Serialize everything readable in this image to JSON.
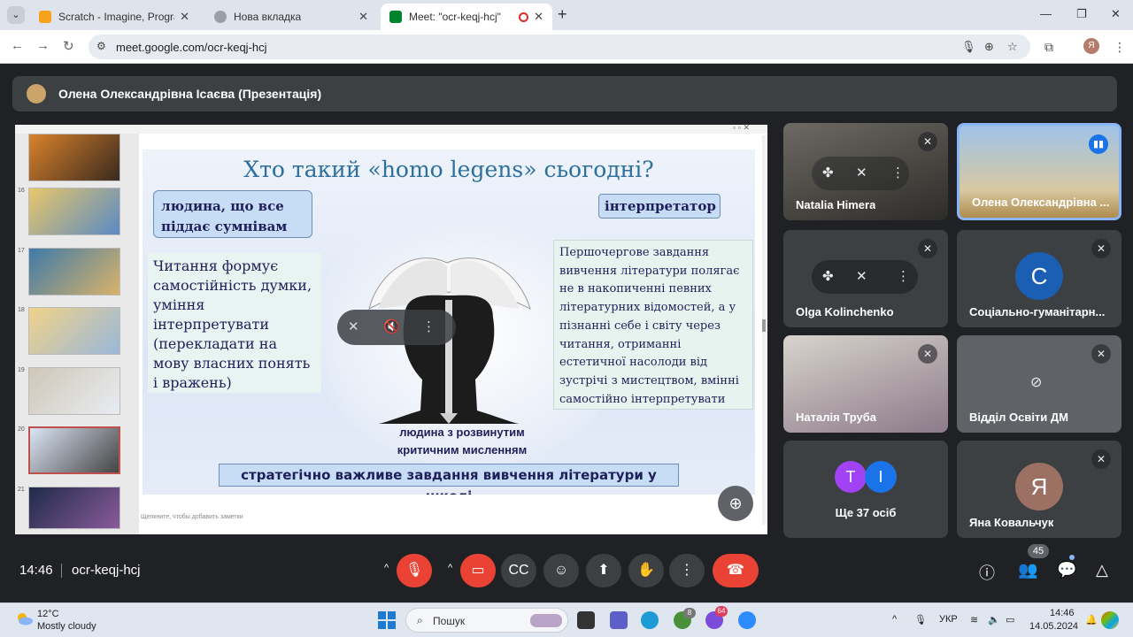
{
  "browser": {
    "tabs": [
      {
        "title": "Scratch - Imagine, Program, Sh",
        "favicon_color": "#f7a21b"
      },
      {
        "title": "Нова вкладка",
        "favicon_color": "#5f6368"
      },
      {
        "title": "Meet: \"ocr-keqj-hcj\"",
        "favicon_color": "#00832d"
      }
    ],
    "url": "meet.google.com/ocr-keqj-hcj",
    "profile_initial": "Я"
  },
  "presenter": {
    "name": "Олена Олександрівна Ісаєва (Презентація)"
  },
  "presentation": {
    "thumbnail_numbers": [
      "16",
      "17",
      "18",
      "19",
      "20",
      "21"
    ],
    "notes_placeholder": "Щелкните, чтобы добавить заметки",
    "slide": {
      "title": "Хто такий «homo legens» сьогодні?",
      "box_doubt": "людина, що все піддає сумнівам",
      "box_interpreter": "інтерпретатор",
      "box_reading": "Читання формує самостійність думки, уміння інтерпретувати (перекладати на мову власних понять і вражень)",
      "box_priority": "Першочергове завдання вивчення літератури полягає не в накопиченні певних літературних відомостей, а у пізнанні себе і світу через читання,  отриманні естетичної насолоди від зустрічі з мистецтвом, вмінні самостійно інтерпретувати",
      "caption": "людина з розвинутим критичним мисленням",
      "bottom_banner": "стратегічно важливе завдання вивчення літератури у школі"
    }
  },
  "participants": [
    {
      "name": "Natalia Himera",
      "state": "muted"
    },
    {
      "name": "Олена Олександрівна ...",
      "state": "speaking"
    },
    {
      "name": "Olga Kolinchenko",
      "state": "muted"
    },
    {
      "name": "Соціально-гуманітарн...",
      "state": "muted",
      "initial": "С",
      "avatar_color": "#1a5fb4"
    },
    {
      "name": "Наталія Труба",
      "state": "muted"
    },
    {
      "name": "Відділ Освіти ДМ",
      "state": "muted"
    },
    {
      "name": "Ще 37 осіб",
      "initials": [
        "Т",
        "І"
      ],
      "colors": [
        "#a142f4",
        "#1a73e8"
      ]
    },
    {
      "name": "Яна Ковальчук",
      "state": "muted",
      "initial": "Я",
      "avatar_color": "#9c7062"
    }
  ],
  "meeting": {
    "time": "14:46",
    "code": "ocr-keqj-hcj",
    "participants_count": "45"
  },
  "taskbar": {
    "temperature": "12°C",
    "condition": "Mostly cloudy",
    "search_placeholder": "Пошук",
    "language": "УКР",
    "clock_time": "14:46",
    "clock_date": "14.05.2024",
    "viber_badge": "64",
    "chrome_badge": "8"
  }
}
